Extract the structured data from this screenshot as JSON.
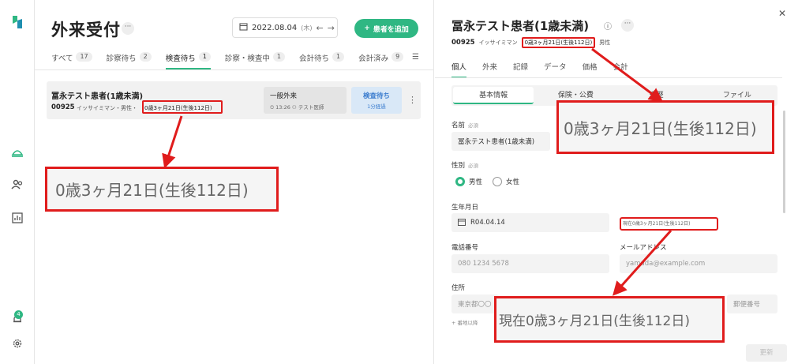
{
  "sidebar": {
    "bell_badge": "4"
  },
  "left": {
    "title": "外来受付",
    "more": "···",
    "date": "2022.08.04",
    "dow": "(木)",
    "add_button": "患者を追加",
    "tabs": [
      {
        "label": "すべて",
        "count": "17"
      },
      {
        "label": "診察待ち",
        "count": "2"
      },
      {
        "label": "検査待ち",
        "count": "1"
      },
      {
        "label": "診察・検査中",
        "count": "1"
      },
      {
        "label": "会計待ち",
        "count": "1"
      },
      {
        "label": "会計済み",
        "count": "9"
      }
    ],
    "card": {
      "name": "冨永テスト患者(1歳未満)",
      "id": "00925",
      "kana": "イッサイミマン・男性・",
      "age": "0歳3ヶ月21日(生後112日)",
      "visit_type": "一般外来",
      "visit_meta": "⏲ 13:26  ⚇ テスト医師",
      "status": "検査待ち",
      "status_sub": "1分経過"
    },
    "zoom_text": "0歳3ヶ月21日(生後112日)"
  },
  "right": {
    "name": "冨永テスト患者(1歳未満)",
    "id": "00925",
    "kana": "イッサイミマン",
    "age": "0歳3ヶ月21日(生後112日)",
    "sex": "男性",
    "tabs": [
      "個人",
      "外来",
      "記録",
      "データ",
      "価格",
      "会計"
    ],
    "subtabs": [
      "基本情報",
      "保険・公費",
      "来歴",
      "ファイル"
    ],
    "fields": {
      "name_label": "名前",
      "required": "必須",
      "name_value": "冨永テスト患者(1歳未満)",
      "sex_label": "性別",
      "male": "男性",
      "female": "女性",
      "birth_label": "生年月日",
      "birth_value": "R04.04.14",
      "current_age": "現在0歳3ヶ月21日(生後112日)",
      "phone_label": "電話番号",
      "phone_value": "080 1234 5678",
      "email_label": "メールアドレス",
      "email_value": "yamada@example.com",
      "address_label": "住所",
      "address_value": "東京都〇〇",
      "zip_placeholder": "郵便番号",
      "address_note": "+ 番地以降"
    },
    "zoom_top": "0歳3ヶ月21日(生後112日)",
    "zoom_bottom": "現在0歳3ヶ月21日(生後112日)",
    "update_button": "更新"
  },
  "colors": {
    "accent": "#2fb783",
    "highlight": "#e01c1c",
    "status_blue": "#3f7fcf"
  }
}
